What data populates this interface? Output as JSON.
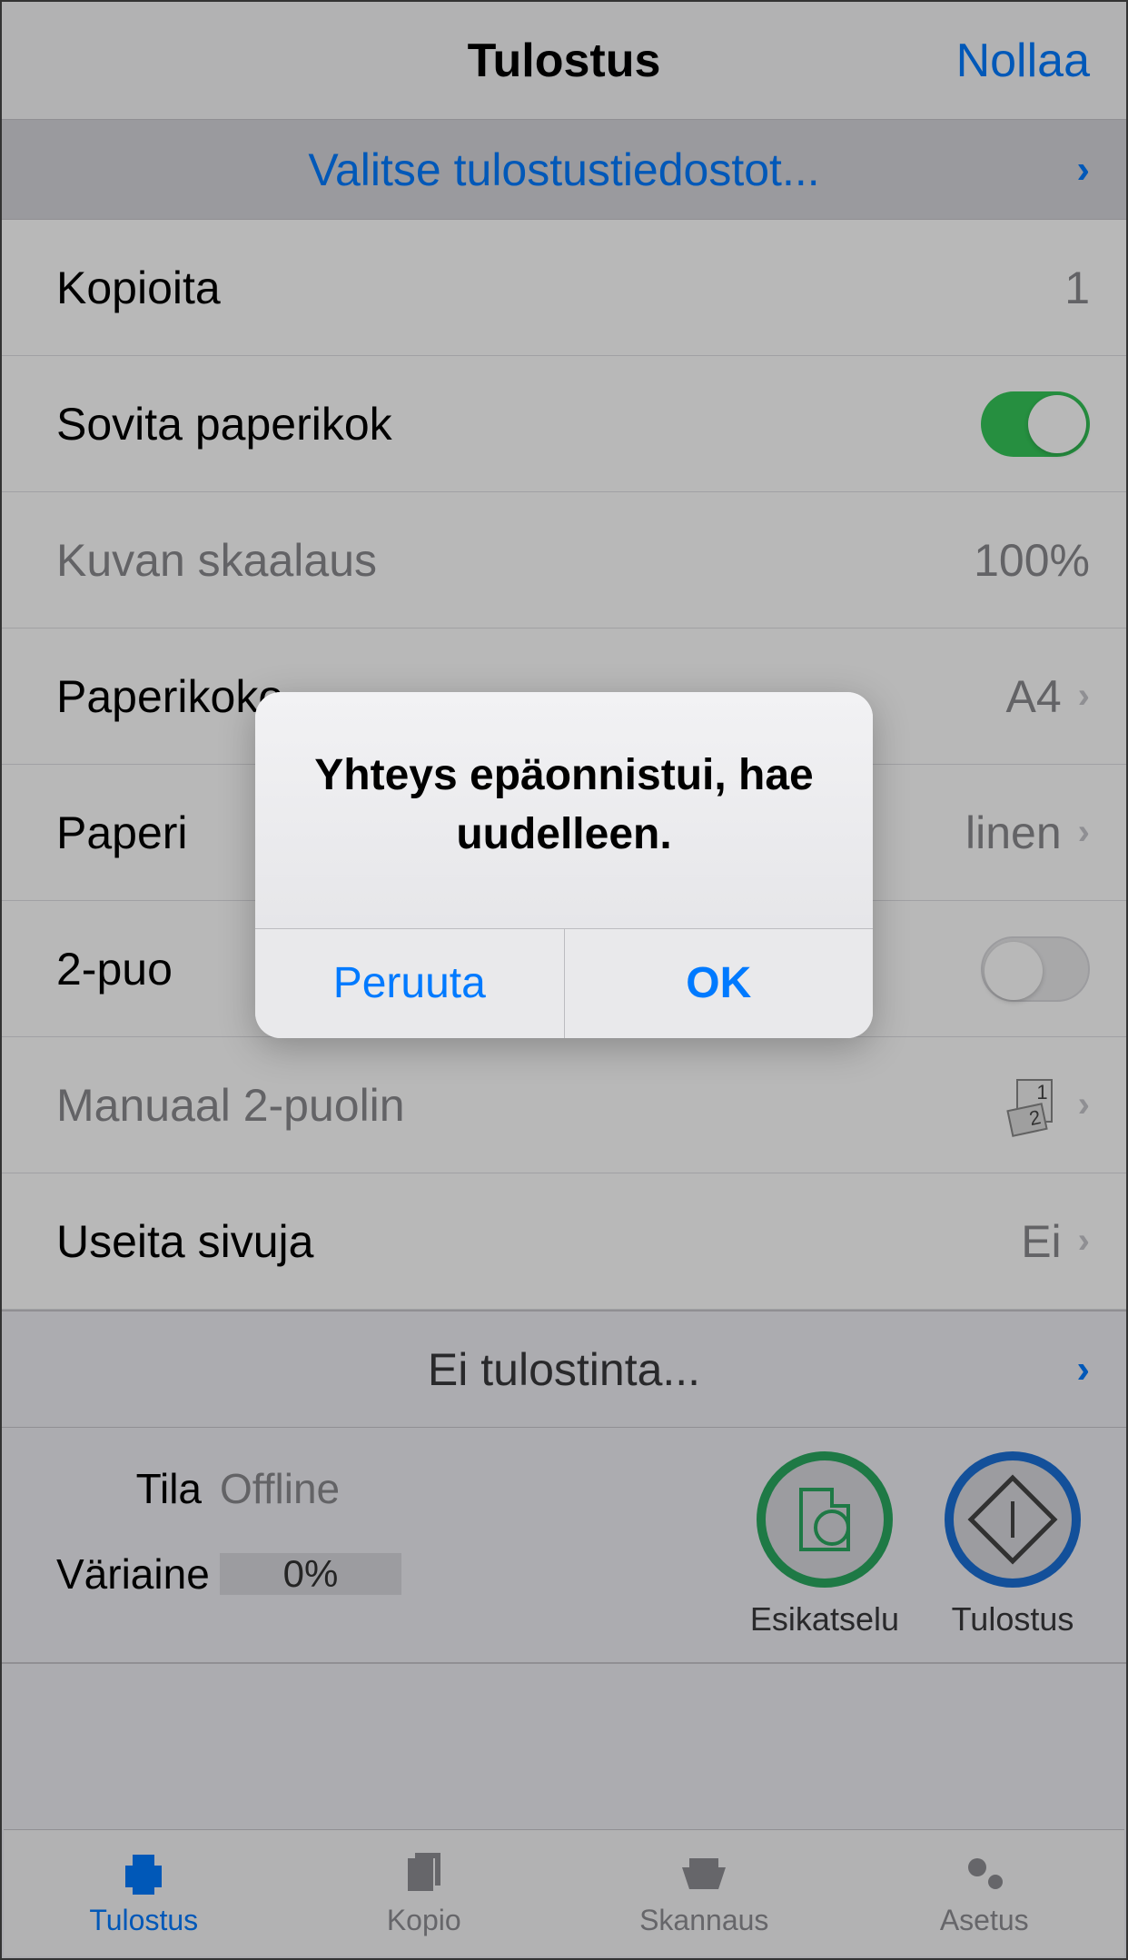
{
  "header": {
    "title": "Tulostus",
    "reset": "Nollaa"
  },
  "select_files": {
    "label": "Valitse tulostustiedostot..."
  },
  "rows": {
    "copies": {
      "label": "Kopioita",
      "value": "1"
    },
    "fit_paper": {
      "label": "Sovita paperikok"
    },
    "image_scale": {
      "label": "Kuvan skaalaus",
      "value": "100%"
    },
    "paper_size": {
      "label": "Paperikoko",
      "value": "A4"
    },
    "paper_type": {
      "label": "Paperi",
      "value_suffix": "linen"
    },
    "two_sided": {
      "label": "2-puo"
    },
    "manual_two_sided": {
      "label": "Manuaal 2-puolin"
    },
    "multiple_pages": {
      "label": "Useita sivuja",
      "value": "Ei"
    }
  },
  "printer": {
    "label": "Ei tulostinta..."
  },
  "status": {
    "label_status": "Tila",
    "value_status": "Offline",
    "label_toner": "Väriaine",
    "value_toner": "0%"
  },
  "actions": {
    "preview": "Esikatselu",
    "print": "Tulostus"
  },
  "tabs": {
    "print": "Tulostus",
    "copy": "Kopio",
    "scan": "Skannaus",
    "settings": "Asetus"
  },
  "alert": {
    "title": "Yhteys epäonnistui, hae uudelleen.",
    "cancel": "Peruuta",
    "ok": "OK"
  }
}
